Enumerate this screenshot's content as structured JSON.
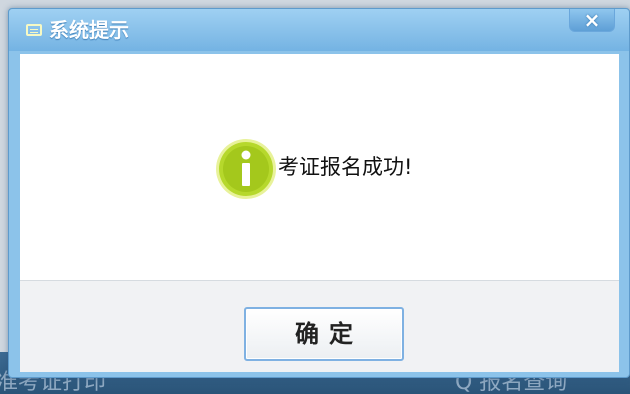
{
  "dialog": {
    "title": "系统提示",
    "close_label": "×",
    "message": "考证报名成功!",
    "ok_label": "确定",
    "icon": "info-icon"
  },
  "background": {
    "left_text": "准考证打印",
    "right_text": "Q 报名查询"
  },
  "colors": {
    "titlebar": "#74b3e3",
    "icon_green": "#b6d82c",
    "button_border": "#7fb1e2"
  }
}
